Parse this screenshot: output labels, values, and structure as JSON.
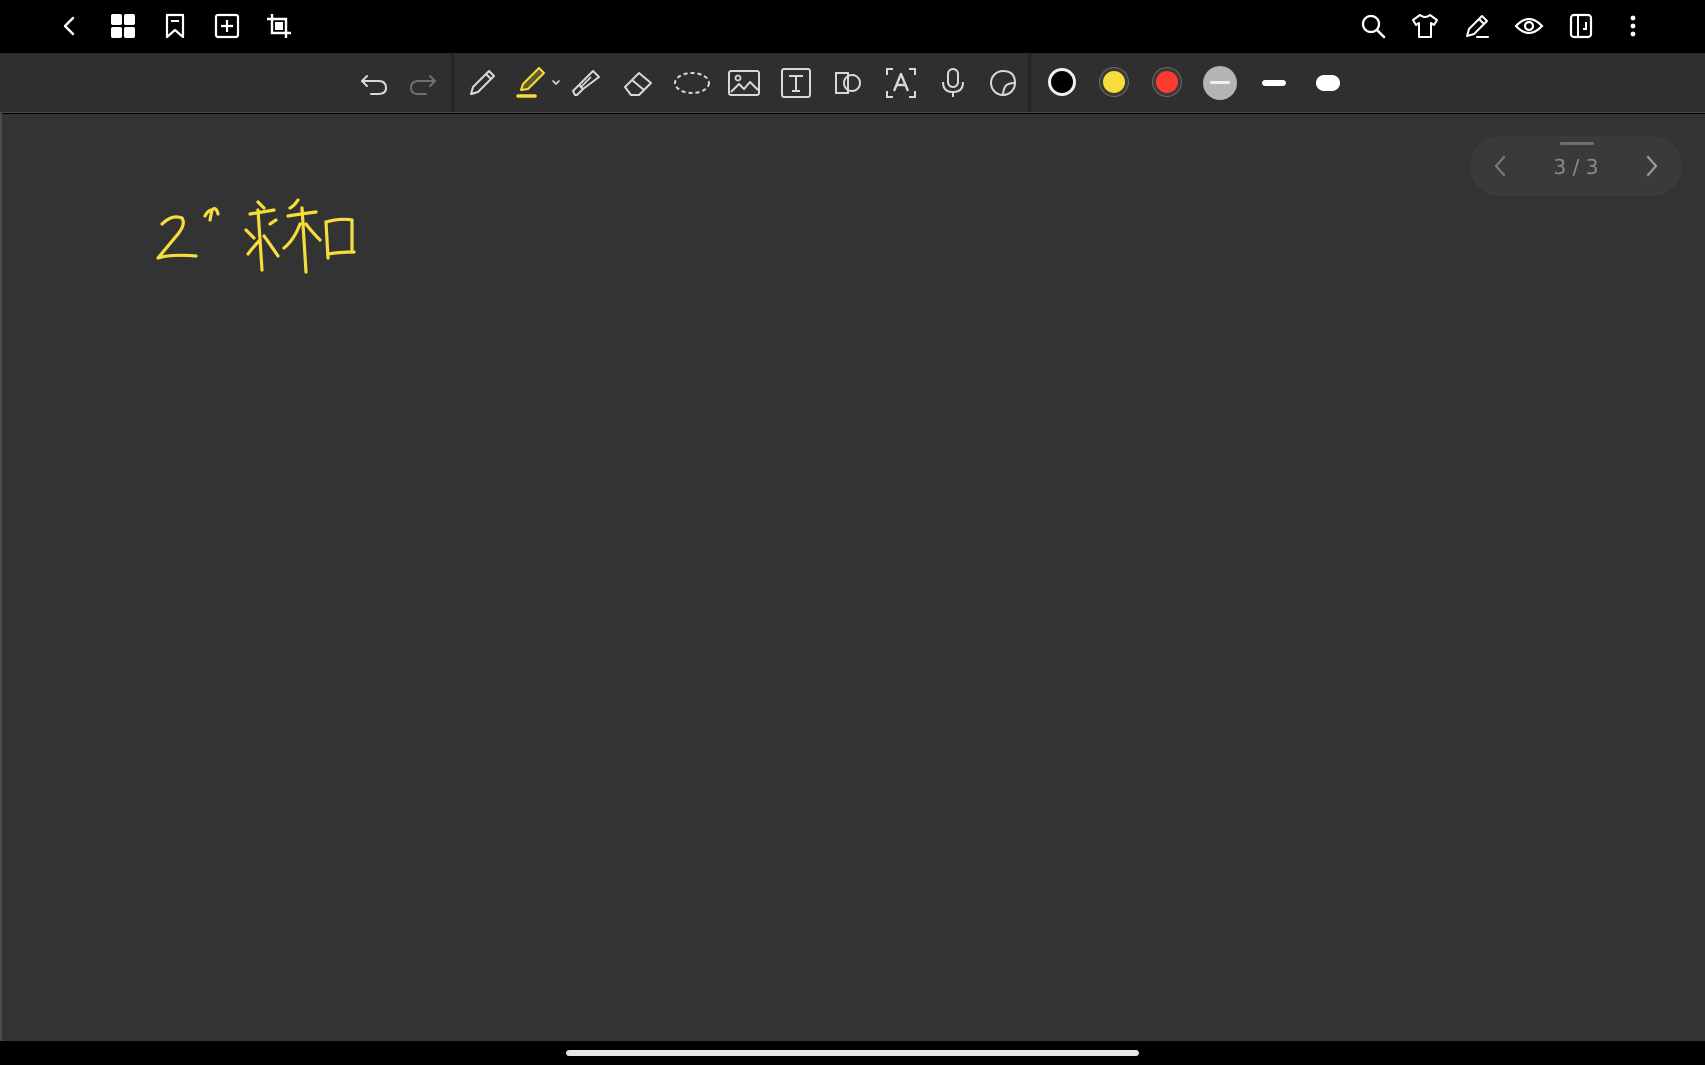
{
  "topbar": {
    "left_icons": [
      "back-icon",
      "grid-icon",
      "bookmark-icon",
      "add-page-icon",
      "crop-icon"
    ],
    "right_icons": [
      "search-icon",
      "shirt-icon",
      "pen-edit-icon",
      "eye-icon",
      "layout-icon",
      "more-vert-icon"
    ]
  },
  "toolbar": {
    "tools": [
      "undo-icon",
      "redo-icon",
      "pen-icon",
      "highlighter-icon",
      "marker-icon",
      "eraser-icon",
      "lasso-icon",
      "image-icon",
      "text-box-icon",
      "shape-icon",
      "text-recognize-icon",
      "microphone-icon",
      "sticker-icon"
    ],
    "colors": [
      "#000000",
      "#f6dd3b",
      "#ff3b30",
      "#b4b4b4"
    ],
    "stroke_sizes": [
      "thin",
      "thick"
    ]
  },
  "canvas": {
    "handwriting_color": "#f6dd3b"
  },
  "page_nav": {
    "counter": "3 / 3"
  }
}
